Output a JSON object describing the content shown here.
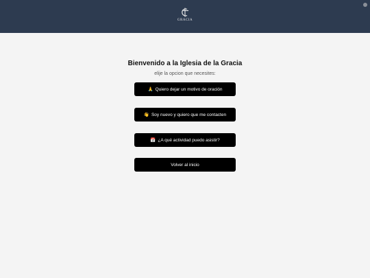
{
  "header": {
    "logo_text": "GRACIA"
  },
  "main": {
    "title": "Bienvenido a la Iglesia de la Gracia",
    "subtitle": "elije la opcion que necesites:",
    "buttons": [
      {
        "emoji": "🙏",
        "label": "Quiero dejar un motivo de oración"
      },
      {
        "emoji": "👋",
        "label": "Soy nuevo y quiero que me contacten"
      },
      {
        "emoji": "📅",
        "label": "¿A qué actividad puedo asistir?"
      },
      {
        "emoji": "",
        "label": "Volver al inicio"
      }
    ]
  },
  "colors": {
    "header_bg": "#2d3b50",
    "page_bg": "#f4f4f4",
    "button_bg": "#000000",
    "button_text": "#ffffff"
  }
}
